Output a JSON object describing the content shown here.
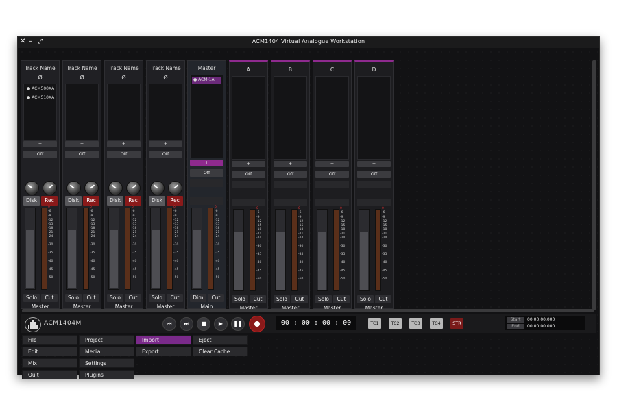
{
  "window": {
    "title": "ACM1404 Virtual Analogue Workstation",
    "close_glyph": "✕",
    "minimize_glyph": "–",
    "maximize_glyph": "⤢"
  },
  "strips": [
    {
      "name": "Track Name",
      "phase": "Ø",
      "plugins": [
        "ACM500XA",
        "ACM510XA"
      ],
      "add": "+",
      "off": "Off",
      "disk": "Disk",
      "rec": "Rec",
      "solo": "Solo",
      "cut": "Cut",
      "output": "Master"
    },
    {
      "name": "Track Name",
      "phase": "Ø",
      "plugins": [],
      "add": "+",
      "off": "Off",
      "disk": "Disk",
      "rec": "Rec",
      "solo": "Solo",
      "cut": "Cut",
      "output": "Master"
    },
    {
      "name": "Track Name",
      "phase": "Ø",
      "plugins": [],
      "add": "+",
      "off": "Off",
      "disk": "Disk",
      "rec": "Rec",
      "solo": "Solo",
      "cut": "Cut",
      "output": "Master"
    },
    {
      "name": "Track Name",
      "phase": "Ø",
      "plugins": [],
      "add": "+",
      "off": "Off",
      "disk": "Disk",
      "rec": "Rec",
      "solo": "Solo",
      "cut": "Cut",
      "output": "Master"
    },
    {
      "name": "Master",
      "plugins": [
        "ACM-1A"
      ],
      "add": "+",
      "off": "Off",
      "solo": "Dim",
      "cut": "Cut",
      "output": "Main"
    },
    {
      "name": "A",
      "add": "+",
      "off": "Off",
      "solo": "Solo",
      "cut": "Cut",
      "output": "Master"
    },
    {
      "name": "B",
      "add": "+",
      "off": "Off",
      "solo": "Solo",
      "cut": "Cut",
      "output": "Master"
    },
    {
      "name": "C",
      "add": "+",
      "off": "Off",
      "solo": "Solo",
      "cut": "Cut",
      "output": "Master"
    },
    {
      "name": "D",
      "add": "+",
      "off": "Off",
      "solo": "Solo",
      "cut": "Cut",
      "output": "Master"
    }
  ],
  "meter_scale": [
    "-6",
    "-9",
    "-12",
    "-15",
    "-18",
    "-21",
    "-24",
    "-30",
    "-35",
    "-40",
    "-45",
    "-50"
  ],
  "meter_scale_top": "0",
  "transport": {
    "logo_text": "ACM1404M",
    "timecode": "00 : 00 : 00 : 00",
    "tc_buttons": [
      "TC1",
      "TC2",
      "TC3",
      "TC4"
    ],
    "str_label": "STR",
    "start_label": "Start",
    "start_value": "00:00:00.000",
    "end_label": "End",
    "end_value": "00:00:00.000"
  },
  "menu": {
    "col1": [
      "File",
      "Edit",
      "Mix",
      "Quit"
    ],
    "col2": [
      "Project",
      "Media",
      "Settings",
      "Plugins"
    ],
    "col3": [
      "Import",
      "Export"
    ],
    "col4": [
      "Eject",
      "Clear Cache"
    ],
    "active": "Import"
  },
  "colors": {
    "accent": "#8e2a8e",
    "record": "#8a1a1a",
    "background": "#121214"
  }
}
